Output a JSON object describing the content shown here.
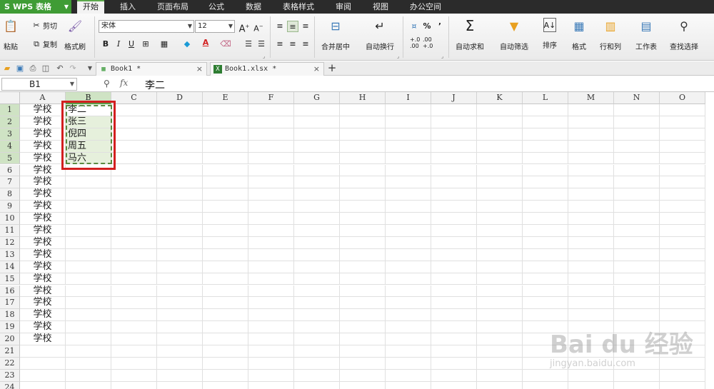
{
  "app": {
    "name": "WPS 表格",
    "logo": "S"
  },
  "menu": {
    "tabs": [
      {
        "label": "开始",
        "active": true
      },
      {
        "label": "插入"
      },
      {
        "label": "页面布局"
      },
      {
        "label": "公式"
      },
      {
        "label": "数据"
      },
      {
        "label": "表格样式"
      },
      {
        "label": "审阅"
      },
      {
        "label": "视图"
      },
      {
        "label": "办公空间"
      }
    ]
  },
  "ribbon": {
    "paste": "粘贴",
    "cut": "剪切",
    "copy": "复制",
    "format_painter": "格式刷",
    "font_name": "宋体",
    "font_size": "12",
    "grow_font": "A",
    "shrink_font": "A",
    "bold": "B",
    "italic": "I",
    "underline": "U",
    "font_color_letter": "A",
    "merge_center": "合并居中",
    "wrap_text": "自动换行",
    "percent": "%",
    "comma": "’",
    "dec_increase": "+.0",
    "dec_increase_sub": ".00",
    "dec_decrease": ".00",
    "dec_decrease_sub": "+.0",
    "autosum": "自动求和",
    "autofilter": "自动筛选",
    "sort": "排序",
    "cell_format": "格式",
    "rows_cols": "行和列",
    "worksheet": "工作表",
    "find_select": "查找选择"
  },
  "doc_tabs": [
    {
      "label": "Book1 *"
    },
    {
      "label": "Book1.xlsx *"
    }
  ],
  "formula_bar": {
    "cell_ref": "B1",
    "fx": "fx",
    "value": "李二"
  },
  "columns": [
    "A",
    "B",
    "C",
    "D",
    "E",
    "F",
    "G",
    "H",
    "I",
    "J",
    "K",
    "L",
    "M",
    "N",
    "O"
  ],
  "rows": [
    "1",
    "2",
    "3",
    "4",
    "5",
    "6",
    "7",
    "8",
    "9",
    "10",
    "11",
    "12",
    "13",
    "14",
    "15",
    "16",
    "17",
    "18",
    "19",
    "20",
    "21",
    "22",
    "23",
    "24"
  ],
  "col_a_values": [
    "学校",
    "学校",
    "学校",
    "学校",
    "学校",
    "学校",
    "学校",
    "学校",
    "学校",
    "学校",
    "学校",
    "学校",
    "学校",
    "学校",
    "学校",
    "学校",
    "学校",
    "学校",
    "学校",
    "学校"
  ],
  "col_b_values": [
    "李二",
    "张三",
    "倪四",
    "周五",
    "马六"
  ],
  "selection": {
    "range": "B1:B5",
    "active": "B1",
    "marquee_color": "#5a8a40",
    "highlight_color": "#d21f1f"
  },
  "colors": {
    "app_green": "#3f9c35",
    "menubar": "#2b2b2b",
    "selection_fill": "#e6f0dc"
  },
  "watermark": {
    "brand": "Bai du 经验",
    "url": "jingyan.baidu.com"
  }
}
